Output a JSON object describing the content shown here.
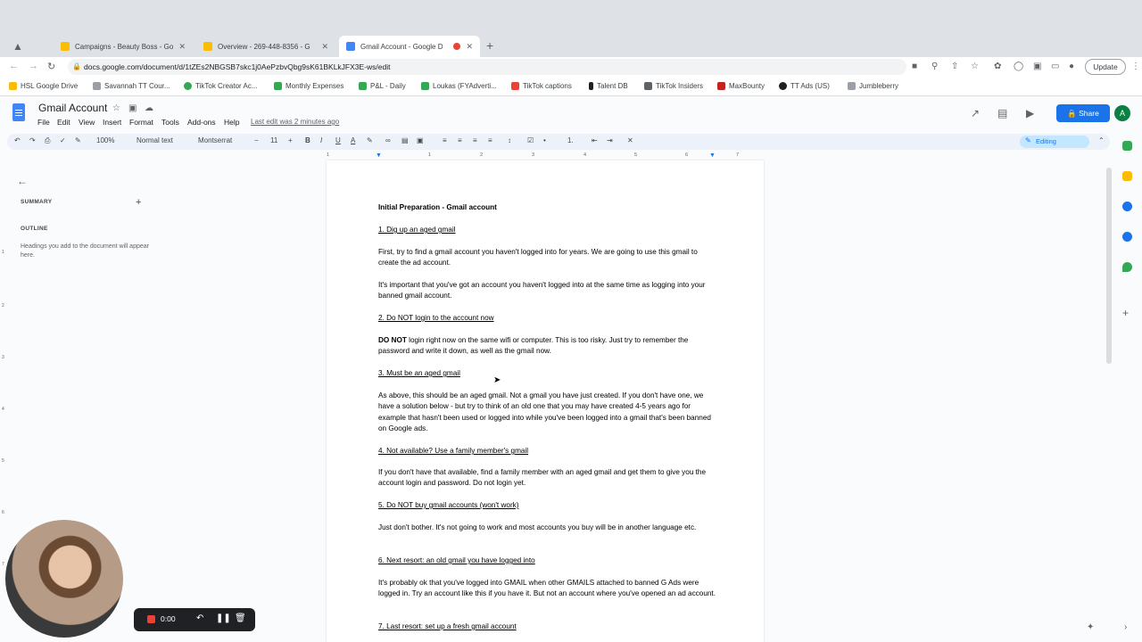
{
  "browser": {
    "tabs": [
      {
        "title": "Campaigns - Beauty Boss - Go",
        "fav_color": "#fbbc04"
      },
      {
        "title": "Overview - 269-448-8356 - G",
        "fav_color": "#fbbc04"
      },
      {
        "title": "Gmail Account - Google D",
        "fav_color": "#4285f4",
        "active": true
      }
    ],
    "new_tab": "+",
    "url": "docs.google.com/document/d/1tZEs2NBGSB7skc1j0AePzbvQbg9sK61BKLkJFX3E-ws/edit",
    "update_label": "Update",
    "bookmarks": [
      {
        "label": "HSL Google Drive",
        "color": "#fbbc04"
      },
      {
        "label": "Savannah TT Cour...",
        "color": "#9aa0a6"
      },
      {
        "label": "TikTok Creator Ac...",
        "color": "#34a853"
      },
      {
        "label": "Monthly Expenses",
        "color": "#34a853"
      },
      {
        "label": "P&L - Daily",
        "color": "#34a853"
      },
      {
        "label": "Loukas (FYAdverti...",
        "color": "#34a853"
      },
      {
        "label": "TikTok captions",
        "color": "#ea4335"
      },
      {
        "label": "Talent DB",
        "color": "#202124"
      },
      {
        "label": "TikTok Insiders",
        "color": "#5f6368"
      },
      {
        "label": "MaxBounty",
        "color": "#c5221f"
      },
      {
        "label": "TT Ads (US)",
        "color": "#202124"
      },
      {
        "label": "Jumbleberry",
        "color": "#9aa0a6"
      }
    ]
  },
  "docs": {
    "title": "Gmail Account",
    "menu": [
      "File",
      "Edit",
      "View",
      "Insert",
      "Format",
      "Tools",
      "Add-ons",
      "Help"
    ],
    "last_edit": "Last edit was 2 minutes ago",
    "share_label": "Share",
    "avatar_letter": "A",
    "toolbar": {
      "zoom": "100%",
      "style": "Normal text",
      "font": "Montserrat",
      "font_size": "11",
      "mode": "Editing"
    }
  },
  "ruler_numbers": [
    "1",
    "1",
    "2",
    "3",
    "4",
    "5",
    "6",
    "7"
  ],
  "vruler_numbers": [
    "1",
    "2",
    "3",
    "4",
    "5",
    "6",
    "7"
  ],
  "sidebar": {
    "summary": "SUMMARY",
    "outline": "OUTLINE",
    "hint": "Headings you add to the document will appear here."
  },
  "document": {
    "title": "Initial Preparation - Gmail account",
    "h1": "1. Dig up an aged gmail",
    "p1": "First, try to find a gmail account you haven't logged into for years. We are going to use this gmail to create the ad account.",
    "p2": "It's important that you've got an account you haven't logged into at the same time as logging into your banned gmail account.",
    "h2": "2. Do NOT login to the account now",
    "p3_bold": "DO NOT",
    "p3_rest": " login right now on the same wifi or computer. This is too risky. Just try to remember the password and write it down, as well as the gmail now.",
    "h3": "3. Must be an aged gmail",
    "p4": "As above, this should be an aged gmail. Not a gmail you have just created. If you don't have one, we have a solution below - but try to think of an old one that you may have created 4-5 years ago for example that hasn't been used or logged into while you've been logged into a gmail that's been banned on Google ads.",
    "h4": "4. Not available? Use a family member's gmail",
    "p5": "If you don't have that available, find a family member with an aged gmail and get them to give you the account login and password. Do not login yet.",
    "h5": "5. Do NOT buy gmail accounts (won't work)",
    "p6": "Just don't bother. It's not going to work and most accounts you buy will be in another language etc.",
    "h6": "6. Next resort: an old gmail you have logged into",
    "p7": "It's probably ok that you've logged into GMAIL when other GMAILS attached to banned G Ads were logged in. Try an account like this if you have it. But not an account where you've opened an ad account.",
    "h7": "7. Last resort: set up a fresh gmail account"
  },
  "recorder": {
    "time": "0:00"
  },
  "colors": {
    "accent": "#1a73e8",
    "record": "#ea4335"
  }
}
